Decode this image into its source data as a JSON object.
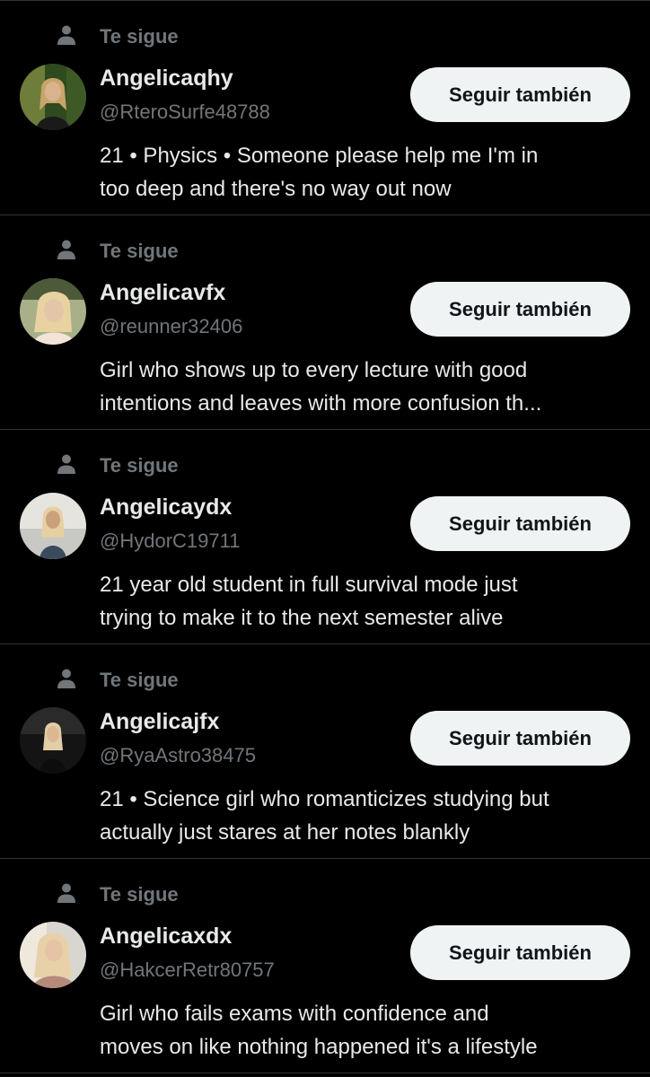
{
  "followers": [
    {
      "context": "Te sigue",
      "name": "Angelicaqhy",
      "handle": "@RteroSurfe48788",
      "button": "Seguir también",
      "bio": "21 • Physics • Someone please help me I'm in\ntoo deep and there's no way out now",
      "avatar_colors": [
        "#2f4a1e",
        "#6e7d3a",
        "#d8b38e",
        "#1a1a1a"
      ]
    },
    {
      "context": "Te sigue",
      "name": "Angelicavfx",
      "handle": "@reunner32406",
      "button": "Seguir también",
      "bio": "Girl who shows up to every lecture with good\nintentions and leaves with more confusion th...",
      "avatar_colors": [
        "#4d5a3a",
        "#a8b08a",
        "#e3c6a8",
        "#f2e4d6"
      ]
    },
    {
      "context": "Te sigue",
      "name": "Angelicaydx",
      "handle": "@HydorC19711",
      "button": "Seguir también",
      "bio": "21 year old student in full survival mode just\ntrying to make it to the next semester alive",
      "avatar_colors": [
        "#c8c8c4",
        "#e6e4de",
        "#c9a27d",
        "#3b4a5c"
      ]
    },
    {
      "context": "Te sigue",
      "name": "Angelicajfx",
      "handle": "@RyaAstro38475",
      "button": "Seguir también",
      "bio": "21 • Science girl who romanticizes studying but\nactually just stares at her notes blankly",
      "avatar_colors": [
        "#141414",
        "#2a2a2a",
        "#e2cda6",
        "#0d0d0d"
      ]
    },
    {
      "context": "Te sigue",
      "name": "Angelicaxdx",
      "handle": "@HakcerRetr80757",
      "button": "Seguir también",
      "bio": "Girl who fails exams with confidence and\nmoves on like nothing happened it's a lifestyle",
      "avatar_colors": [
        "#d9d6d0",
        "#efe8dc",
        "#e8d0a8",
        "#b58a7a"
      ]
    }
  ],
  "colors": {
    "background": "#000000",
    "primary_text": "#e7e9ea",
    "secondary_text": "#71767b",
    "divider": "#2f3336",
    "button_bg": "#eff3f4",
    "button_text": "#0f1419"
  },
  "icons": {
    "context_icon": "person-icon"
  }
}
